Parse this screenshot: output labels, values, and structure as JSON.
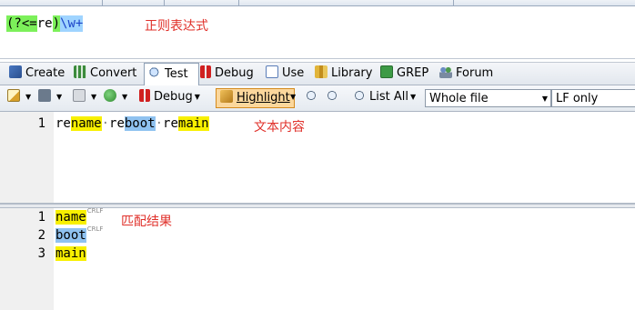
{
  "regex": {
    "tokens": [
      {
        "text": "(?<=",
        "style": "green"
      },
      {
        "text": "re",
        "style": "plain"
      },
      {
        "text": ")",
        "style": "green"
      },
      {
        "text": "\\w+",
        "style": "blue"
      }
    ],
    "note": "正则表达式"
  },
  "tabs": [
    {
      "label": "Create",
      "icon": "create-icon"
    },
    {
      "label": "Convert",
      "icon": "convert-icon"
    },
    {
      "label": "Test",
      "icon": "test-magnifier-icon",
      "active": true
    },
    {
      "label": "Debug",
      "icon": "debug-icon"
    },
    {
      "label": "Use",
      "icon": "use-icon"
    },
    {
      "label": "Library",
      "icon": "library-icon"
    },
    {
      "label": "GREP",
      "icon": "grep-icon"
    },
    {
      "label": "Forum",
      "icon": "forum-icon"
    }
  ],
  "toolbar": {
    "debug_label": "Debug",
    "highlight_label": "Highlight",
    "list_all_label": "List All",
    "scope_select": "Whole file",
    "line_break_select": "LF only"
  },
  "text_panel": {
    "line_number": "1",
    "segments": [
      {
        "text": "re",
        "hl": ""
      },
      {
        "text": "name",
        "hl": "yellow"
      },
      {
        "text": "·",
        "hl": "dot"
      },
      {
        "text": "re",
        "hl": ""
      },
      {
        "text": "boot",
        "hl": "blue"
      },
      {
        "text": "·",
        "hl": "dot"
      },
      {
        "text": "re",
        "hl": ""
      },
      {
        "text": "main",
        "hl": "yellow"
      }
    ],
    "note": "文本内容"
  },
  "result_panel": {
    "lines": [
      {
        "no": "1",
        "text": "name",
        "hl": "yellow",
        "eol": "CRLF"
      },
      {
        "no": "2",
        "text": "boot",
        "hl": "blue",
        "eol": "CRLF"
      },
      {
        "no": "3",
        "text": "main",
        "hl": "yellow",
        "eol": ""
      }
    ],
    "note": "匹配结果"
  },
  "colors": {
    "regex_group": "#7cf05a",
    "regex_token": "#9fd4ff",
    "match_yellow": "#f8f000",
    "match_blue": "#8fc2f0",
    "annotation_red": "#e0302a",
    "active_tab_button": "#fbd79c"
  }
}
